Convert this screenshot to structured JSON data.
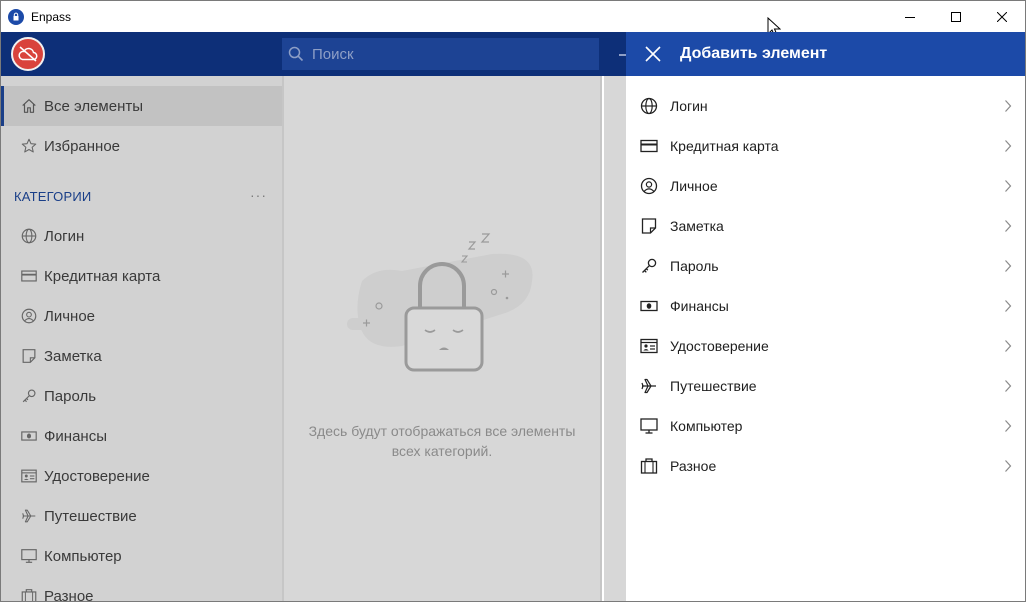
{
  "window": {
    "title": "Enpass"
  },
  "header": {
    "search_placeholder": "Поиск"
  },
  "sidebar": {
    "top_items": [
      {
        "label": "Все элементы",
        "icon": "home-icon"
      },
      {
        "label": "Избранное",
        "icon": "star-icon"
      }
    ],
    "categories_header": "КАТЕГОРИИ",
    "categories_more": "···",
    "categories": [
      {
        "label": "Логин",
        "icon": "globe-icon"
      },
      {
        "label": "Кредитная карта",
        "icon": "credit-card-icon"
      },
      {
        "label": "Личное",
        "icon": "person-icon"
      },
      {
        "label": "Заметка",
        "icon": "note-icon"
      },
      {
        "label": "Пароль",
        "icon": "key-icon"
      },
      {
        "label": "Финансы",
        "icon": "banknote-icon"
      },
      {
        "label": "Удостоверение",
        "icon": "id-card-icon"
      },
      {
        "label": "Путешествие",
        "icon": "airplane-icon"
      },
      {
        "label": "Компьютер",
        "icon": "monitor-icon"
      },
      {
        "label": "Разное",
        "icon": "briefcase-icon"
      }
    ]
  },
  "list": {
    "empty_line1": "Здесь будут отображаться все элементы",
    "empty_line2": "всех категорий."
  },
  "panel": {
    "title": "Добавить элемент",
    "items": [
      {
        "label": "Логин",
        "icon": "globe-icon"
      },
      {
        "label": "Кредитная карта",
        "icon": "credit-card-icon"
      },
      {
        "label": "Личное",
        "icon": "person-icon"
      },
      {
        "label": "Заметка",
        "icon": "note-icon"
      },
      {
        "label": "Пароль",
        "icon": "key-icon"
      },
      {
        "label": "Финансы",
        "icon": "banknote-icon"
      },
      {
        "label": "Удостоверение",
        "icon": "id-card-icon"
      },
      {
        "label": "Путешествие",
        "icon": "airplane-icon"
      },
      {
        "label": "Компьютер",
        "icon": "monitor-icon"
      },
      {
        "label": "Разное",
        "icon": "briefcase-icon"
      }
    ]
  },
  "colors": {
    "accent": "#1c4aa8",
    "header_dimmed": "#0d2f78",
    "sync_button": "#d9433c"
  }
}
